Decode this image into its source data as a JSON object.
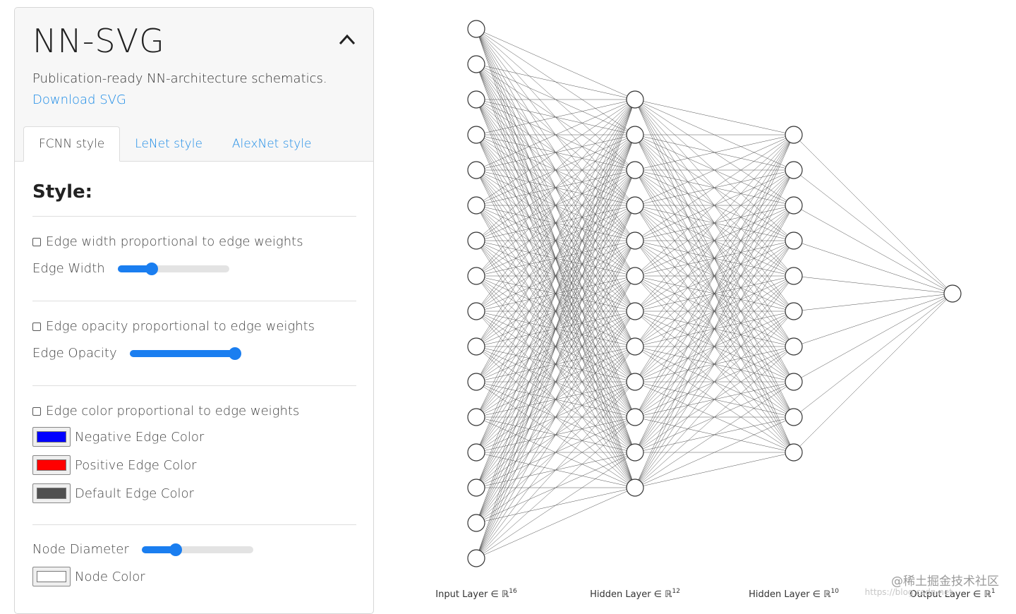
{
  "app": {
    "title": "NN-SVG",
    "tagline": "Publication-ready NN-architecture schematics.",
    "download_label": "Download SVG"
  },
  "tabs": [
    {
      "label": "FCNN style",
      "active": true
    },
    {
      "label": "LeNet style",
      "active": false
    },
    {
      "label": "AlexNet style",
      "active": false
    }
  ],
  "style": {
    "heading": "Style:",
    "edge_width_prop_label": "Edge width proportional to edge weights",
    "edge_width_prop_checked": false,
    "edge_width_label": "Edge Width",
    "edge_width_value": 0.28,
    "edge_opacity_prop_label": "Edge opacity proportional to edge weights",
    "edge_opacity_prop_checked": false,
    "edge_opacity_label": "Edge Opacity",
    "edge_opacity_value": 1.0,
    "edge_color_prop_label": "Edge color proportional to edge weights",
    "edge_color_prop_checked": false,
    "negative_color_label": "Negative Edge Color",
    "negative_color": "#0000ff",
    "positive_color_label": "Positive Edge Color",
    "positive_color": "#ff0000",
    "default_color_label": "Default Edge Color",
    "default_color": "#505050",
    "node_diameter_label": "Node Diameter",
    "node_diameter_value": 0.28,
    "node_color_label": "Node Color",
    "node_color": "#ffffff"
  },
  "network": {
    "layers": [
      {
        "label": "Input Layer ∈ ℝ",
        "exp": "16",
        "size": 16
      },
      {
        "label": "Hidden Layer ∈ ℝ",
        "exp": "12",
        "size": 12
      },
      {
        "label": "Hidden Layer ∈ ℝ",
        "exp": "10",
        "size": 10
      },
      {
        "label": "Output Layer ∈ ℝ",
        "exp": "1",
        "size": 1
      }
    ],
    "edge_color": "#505050",
    "node_stroke": "#333333"
  },
  "watermark": "@稀土掘金技术社区",
  "watermark_sub": "https://blog.csdn.net"
}
